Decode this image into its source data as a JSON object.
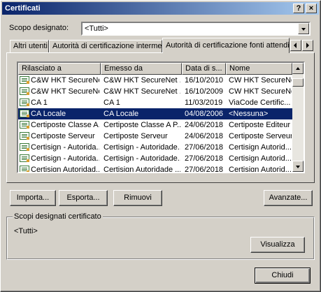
{
  "window": {
    "title": "Certificati",
    "help_label": "?",
    "close_label": "×"
  },
  "scope": {
    "label": "Scopo designato:",
    "value": "<Tutti>"
  },
  "tabs": [
    {
      "label": "Altri utenti"
    },
    {
      "label": "Autorità di certificazione intermedie"
    },
    {
      "label": "Autorità di certificazione fonti attendibili"
    }
  ],
  "table": {
    "columns": [
      "Rilasciato a",
      "Emesso da",
      "Data di s...",
      "Nome"
    ],
    "rows": [
      {
        "issued_to": "C&W HKT SecureNe...",
        "issued_by": "C&W HKT SecureNet ...",
        "date": "16/10/2010",
        "name": "CW HKT SecureNet ..."
      },
      {
        "issued_to": "C&W HKT SecureNe...",
        "issued_by": "C&W HKT SecureNet ...",
        "date": "16/10/2009",
        "name": "CW HKT SecureNet ..."
      },
      {
        "issued_to": "CA 1",
        "issued_by": "CA 1",
        "date": "11/03/2019",
        "name": "ViaCode Certific..."
      },
      {
        "issued_to": "CA Locale",
        "issued_by": "CA Locale",
        "date": "04/08/2006",
        "name": "<Nessuna>",
        "selected": true
      },
      {
        "issued_to": "Certiposte Classe A...",
        "issued_by": "Certiposte Classe A P...",
        "date": "24/06/2018",
        "name": "Certiposte Editeur"
      },
      {
        "issued_to": "Certiposte Serveur",
        "issued_by": "Certiposte Serveur",
        "date": "24/06/2018",
        "name": "Certiposte Serveur"
      },
      {
        "issued_to": "Certisign - Autorida...",
        "issued_by": "Certisign - Autoridade...",
        "date": "27/06/2018",
        "name": "Certisign Autorid..."
      },
      {
        "issued_to": "Certisign - Autorida...",
        "issued_by": "Certisign - Autoridade...",
        "date": "27/06/2018",
        "name": "Certisign Autorid..."
      },
      {
        "issued_to": "Certisign Autoridad...",
        "issued_by": "Certisign Autoridade ...",
        "date": "27/06/2018",
        "name": "Certisign Autorid..."
      }
    ]
  },
  "buttons": {
    "import": "Importa...",
    "export": "Esporta...",
    "remove": "Rimuovi",
    "advanced": "Avanzate...",
    "view": "Visualizza",
    "close": "Chiudi"
  },
  "group": {
    "label": "Scopi designati certificato",
    "value": "<Tutti>"
  }
}
